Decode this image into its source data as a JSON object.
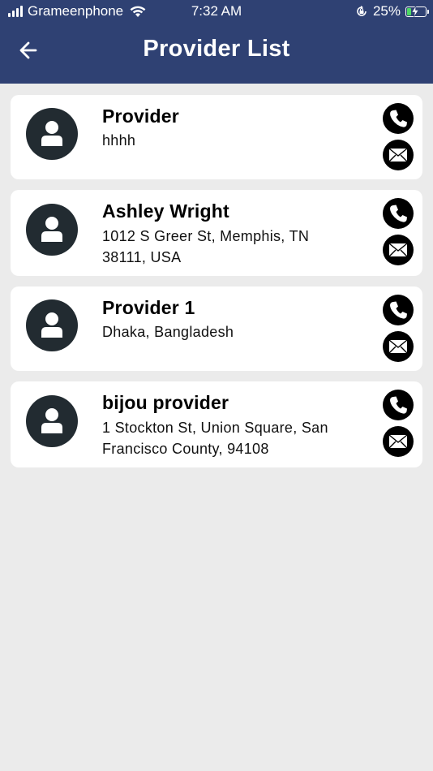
{
  "status_bar": {
    "carrier": "Grameenphone",
    "time": "7:32 AM",
    "battery": "25%",
    "battery_level": 0.25
  },
  "header": {
    "title": "Provider List",
    "back_icon": "arrow-left-icon",
    "background_color": "#2f4173"
  },
  "providers": [
    {
      "name": "Provider",
      "address": "hhhh"
    },
    {
      "name": "Ashley Wright",
      "address": "1012 S Greer St, Memphis, TN 38111, USA"
    },
    {
      "name": "Provider 1",
      "address": "Dhaka, Bangladesh"
    },
    {
      "name": "bijou provider",
      "address": "1 Stockton St, Union Square, San Francisco County, 94108"
    }
  ],
  "icons": {
    "avatar": "person-icon",
    "call": "phone-icon",
    "email": "envelope-icon"
  }
}
